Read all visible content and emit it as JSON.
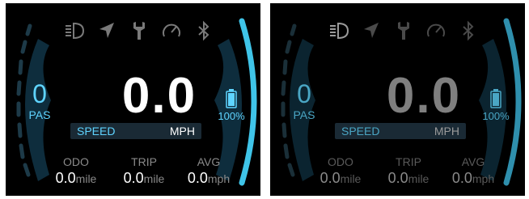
{
  "icons": [
    "headlight-icon",
    "navigation-icon",
    "wrench-icon",
    "speedometer-icon",
    "bluetooth-icon"
  ],
  "colors": {
    "accent": "#5fd4ff",
    "accent_dim": "#4aa6c4",
    "panel_bg": "#000000",
    "gauge_fill": "#0e2d3d"
  },
  "screens": [
    {
      "state": "active",
      "pas": {
        "value": "0",
        "label": "PAS"
      },
      "speed": {
        "value": "0.0",
        "label": "SPEED",
        "unit": "MPH"
      },
      "battery": {
        "percent": "100%",
        "level": 1.0
      },
      "stats": {
        "odo": {
          "label": "ODO",
          "value": "0.0",
          "unit": "mile"
        },
        "trip": {
          "label": "TRIP",
          "value": "0.0",
          "unit": "mile"
        },
        "avg": {
          "label": "AVG",
          "value": "0.0",
          "unit": "mph"
        }
      }
    },
    {
      "state": "dimmed",
      "pas": {
        "value": "0",
        "label": "PAS"
      },
      "speed": {
        "value": "0.0",
        "label": "SPEED",
        "unit": "MPH"
      },
      "battery": {
        "percent": "100%",
        "level": 1.0
      },
      "stats": {
        "odo": {
          "label": "ODO",
          "value": "0.0",
          "unit": "mile"
        },
        "trip": {
          "label": "TRIP",
          "value": "0.0",
          "unit": "mile"
        },
        "avg": {
          "label": "AVG",
          "value": "0.0",
          "unit": "mph"
        }
      }
    }
  ]
}
